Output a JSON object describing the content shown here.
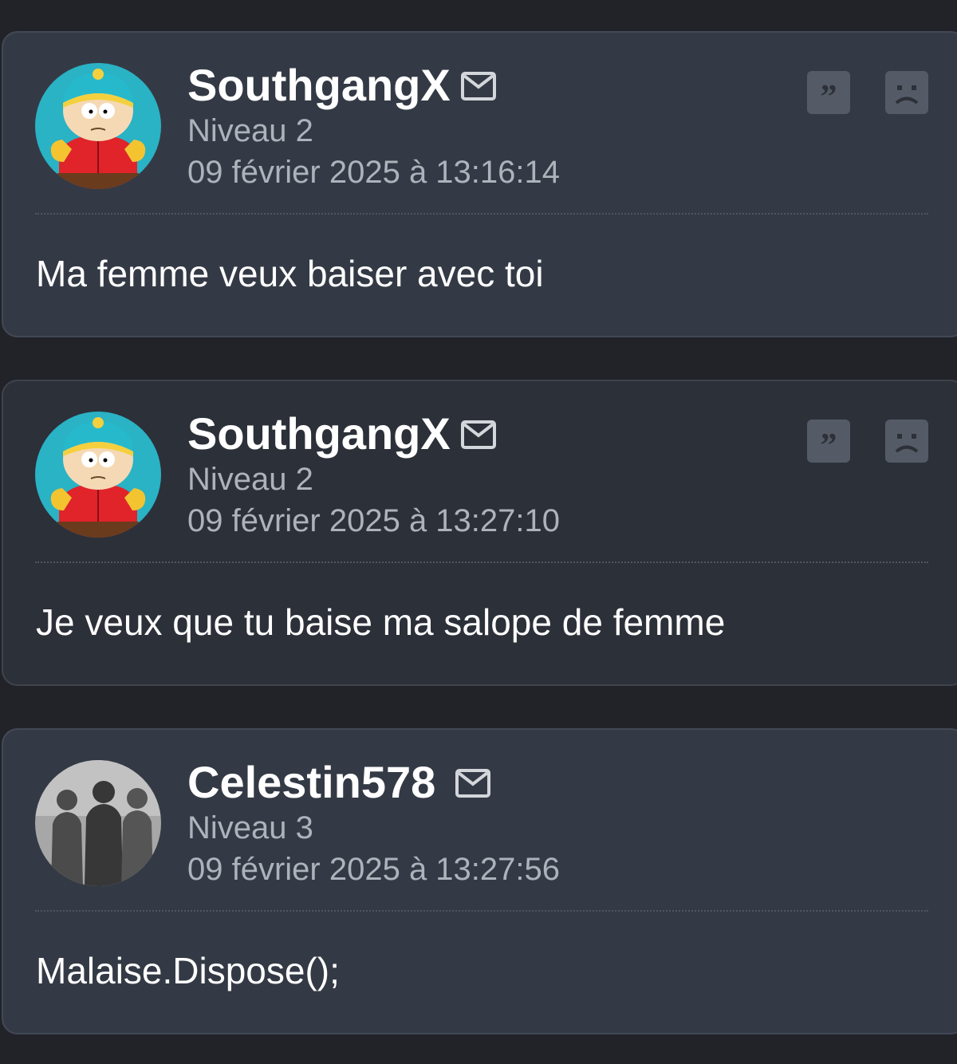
{
  "posts": [
    {
      "author": "SouthgangX",
      "level": "Niveau 2",
      "date": "09 février 2025 à 13:16:14",
      "message": "Ma femme veux baiser avec toi",
      "avatar": "cartman-avatar",
      "icons": {
        "mail": "mail-icon",
        "quote": "quote-icon",
        "sad": "sad-face-icon"
      }
    },
    {
      "author": "SouthgangX",
      "level": "Niveau 2",
      "date": "09 février 2025 à 13:27:10",
      "message": "Je veux que tu baise ma salope de femme",
      "avatar": "cartman-avatar",
      "icons": {
        "mail": "mail-icon",
        "quote": "quote-icon",
        "sad": "sad-face-icon"
      }
    },
    {
      "author": "Celestin578",
      "level": "Niveau 3",
      "date": "09 février 2025 à 13:27:56",
      "message": "Malaise.Dispose();",
      "avatar": "silhouettes-avatar",
      "icons": {
        "mail": "mail-icon"
      }
    }
  ],
  "colors": {
    "page_background": "#212329",
    "card_background": "#343a45",
    "card_background_alt": "#2c3039",
    "meta_text": "#adb2bb",
    "button_background": "#555b66"
  }
}
